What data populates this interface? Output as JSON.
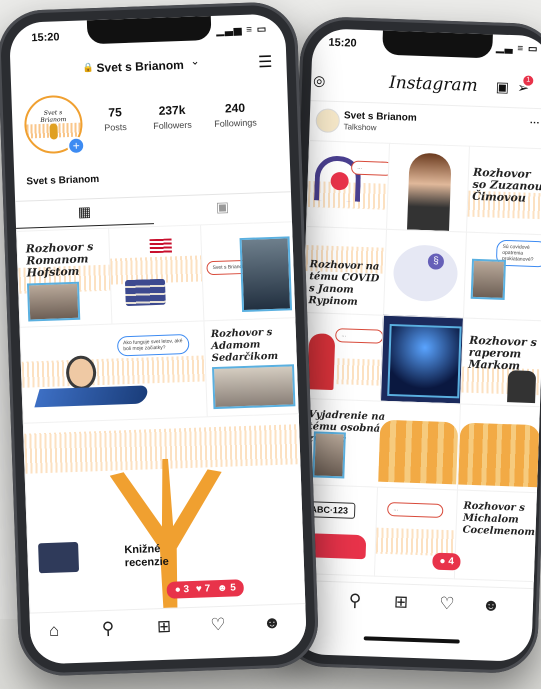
{
  "left_phone": {
    "time": "15:20",
    "status_icons": "▁▃▅ ≡ ▭",
    "lock_icon": "🔒",
    "username": "Svet s Brianom",
    "menu_icon": "☰",
    "avatar_text": "Svet s Brianom",
    "stats": [
      {
        "value": "75",
        "label": "Posts"
      },
      {
        "value": "237k",
        "label": "Followers"
      },
      {
        "value": "240",
        "label": "Followings"
      }
    ],
    "display_name": "Svet s Brianom",
    "posts": {
      "p1_title": "Rozhovor s Romanom Hofstom",
      "p3_bubble": "Svet s Brianom",
      "p4_bubble": "Ako funguje svet letov, aké boli moje začiatky?",
      "p5_title": "Rozhovor s Adamom Sedarčikom",
      "p6_title": "Knižné recenzie"
    },
    "notification": {
      "comments": "3",
      "likes": "7",
      "follows": "5"
    }
  },
  "right_phone": {
    "time": "15:20",
    "status_icons": "▁▃ ≡ ▭",
    "brand": "Instagram",
    "dm_badge": "1",
    "post_author": "Svet s Brianom",
    "post_subtitle": "Talkshow",
    "more_icon": "···",
    "posts": {
      "r2_title": "Rozhovor so Zuzanou Čimovou",
      "r3_bubble": "Sú covidové opatrenia prokiatanové?",
      "r4_title": "Rozhovor na tému COVID s Janom Rypinom",
      "r5_title": "Rozhovor s raperom Markom",
      "r6_title": "Vyjadrenie na tému osobná značka",
      "r7_plate": "ABC·123",
      "r8_title": "Rozhovor s Michalom Cocelmenom"
    },
    "notification": {
      "comments": "4"
    }
  },
  "icons": {
    "home": "⌂",
    "search": "⚲",
    "add": "⊞",
    "heart": "♡",
    "profile": "☻",
    "grid": "▦",
    "tagged": "▣",
    "chevron": "⌄",
    "heart_filled": "♥",
    "chat": "●",
    "person": "☻"
  },
  "colors": {
    "accent_orange": "#f0a030",
    "notif_red": "#e8334a",
    "blue_button": "#3d8bf2"
  }
}
